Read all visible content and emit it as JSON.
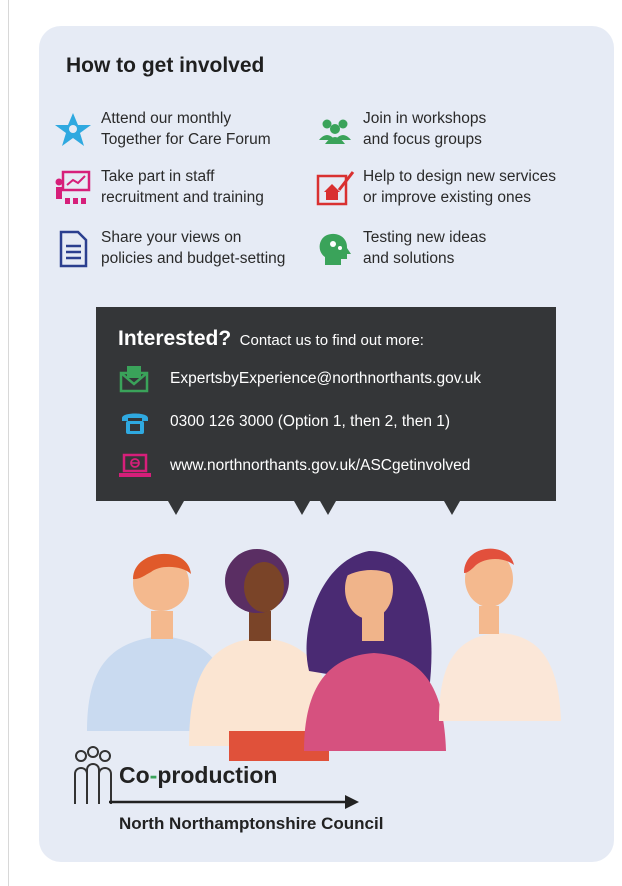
{
  "heading": "How to get involved",
  "items": [
    {
      "icon": "star-people-icon",
      "lines": [
        "Attend our monthly",
        "Together for Care Forum"
      ]
    },
    {
      "icon": "group-icon",
      "lines": [
        "Join in workshops",
        "and focus groups"
      ]
    },
    {
      "icon": "presentation-icon",
      "lines": [
        "Take part in staff",
        "recruitment and training"
      ]
    },
    {
      "icon": "house-design-icon",
      "lines": [
        "Help to design new services",
        "or improve existing ones"
      ]
    },
    {
      "icon": "document-icon",
      "lines": [
        "Share your views on",
        "policies and budget-setting"
      ]
    },
    {
      "icon": "head-ideas-icon",
      "lines": [
        "Testing new ideas",
        "and solutions"
      ]
    }
  ],
  "contact": {
    "title": "Interested?",
    "subtitle": "Contact us to find out more:",
    "email": "ExpertsbyExperience@northnorthants.gov.uk",
    "phone": "0300 126 3000 (Option 1, then 2, then 1)",
    "website": "www.northnorthants.gov.uk/ASCgetinvolved"
  },
  "logo": {
    "co": "Co",
    "o": "-",
    "rest": "production",
    "council": "North Northamptonshire Council"
  },
  "colors": {
    "card_bg": "#e6ebf5",
    "contact_bg": "#343638",
    "icon_blue": "#2fa9e0",
    "icon_green": "#3aa35a",
    "icon_magenta": "#d61f7a",
    "icon_red": "#d93030",
    "icon_navy": "#2b3f8f"
  }
}
